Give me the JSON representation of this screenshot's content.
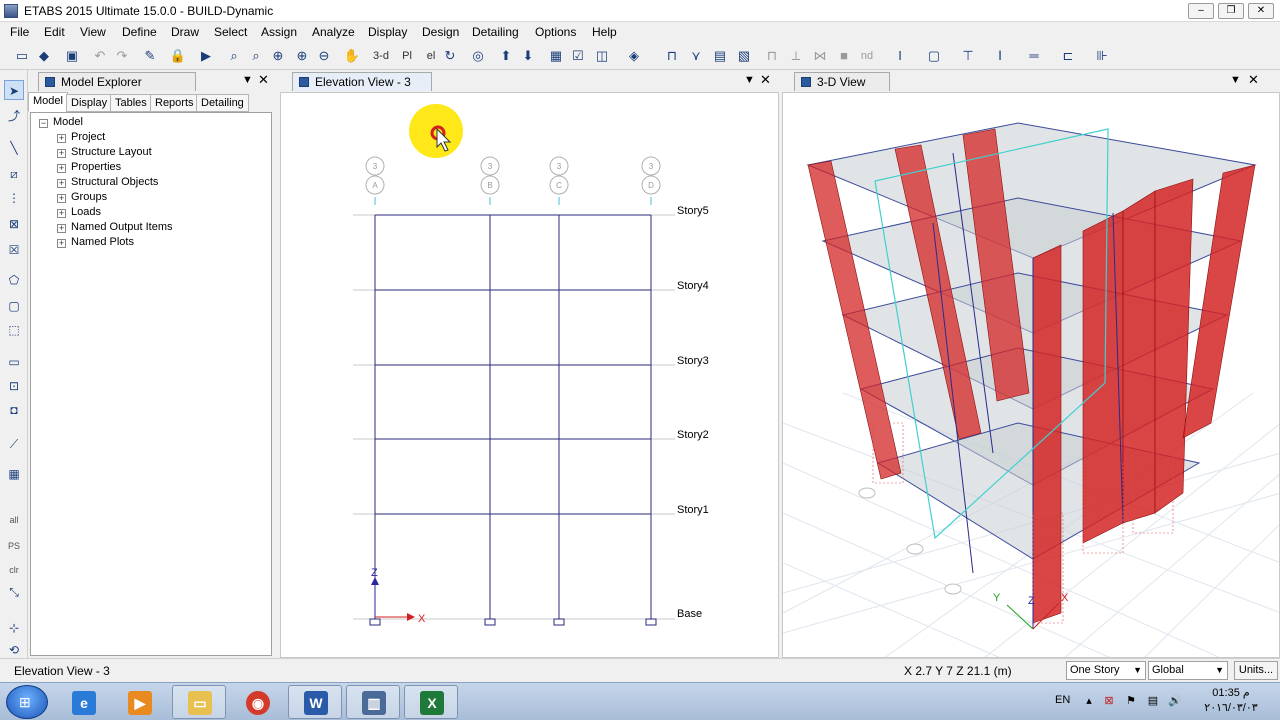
{
  "window": {
    "title": "ETABS 2015 Ultimate 15.0.0 - BUILD-Dynamic"
  },
  "menu": [
    "File",
    "Edit",
    "View",
    "Define",
    "Draw",
    "Select",
    "Assign",
    "Analyze",
    "Display",
    "Design",
    "Detailing",
    "Options",
    "Help"
  ],
  "toolbar": {
    "view3d_label": "3-d",
    "plan_label": "Pl",
    "elev_label": "el",
    "nd_label": "nd"
  },
  "left_tools": {
    "all_label": "all",
    "ps_label": "PS",
    "clr_label": "clr"
  },
  "explorer": {
    "title": "Model Explorer",
    "tabs": [
      "Model",
      "Display",
      "Tables",
      "Reports",
      "Detailing"
    ],
    "root": "Model",
    "nodes": [
      "Project",
      "Structure Layout",
      "Properties",
      "Structural Objects",
      "Groups",
      "Loads",
      "Named Output Items",
      "Named Plots"
    ]
  },
  "elevation": {
    "tab": "Elevation View - 3",
    "grid_bubbles": [
      {
        "top": "3",
        "bottom": "A"
      },
      {
        "top": "3",
        "bottom": "B"
      },
      {
        "top": "3",
        "bottom": "C"
      },
      {
        "top": "3",
        "bottom": "D"
      }
    ],
    "stories": [
      "Story5",
      "Story4",
      "Story3",
      "Story2",
      "Story1",
      "Base"
    ],
    "axis_z": "Z",
    "axis_x": "X"
  },
  "view3d": {
    "tab": "3-D View",
    "axis_z": "Z",
    "axis_y": "Y",
    "axis_x": "X"
  },
  "status": {
    "view_name": "Elevation View - 3",
    "coords": "X 2.7  Y 7  Z 21.1  (m)",
    "story_select": "One Story",
    "coord_select": "Global",
    "units_button": "Units..."
  },
  "taskbar": {
    "lang": "EN",
    "time": "01:35 م",
    "date": "٢٠١٦/٠٣/٠٣"
  },
  "colors": {
    "frame": "#2a2a7a",
    "shear_wall": "#d42525",
    "highlight": "#ffe600",
    "slab": "#c8c8c8"
  }
}
